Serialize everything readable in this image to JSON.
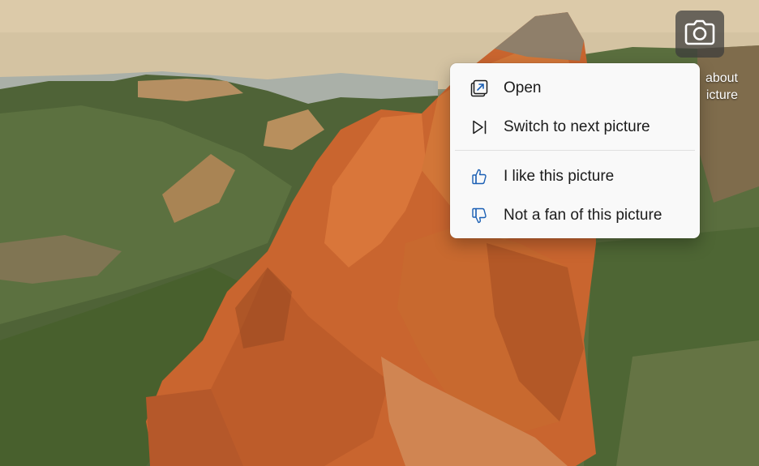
{
  "camera_button": {
    "icon": "camera-icon"
  },
  "caption": {
    "line1": "about",
    "line2": "icture"
  },
  "context_menu": {
    "items": [
      {
        "label": "Open",
        "icon": "open-external-icon"
      },
      {
        "label": "Switch to next picture",
        "icon": "next-track-icon"
      },
      {
        "label": "I like this picture",
        "icon": "thumbs-up-icon"
      },
      {
        "label": "Not a fan of this picture",
        "icon": "thumbs-down-icon"
      }
    ]
  },
  "colors": {
    "accent": "#1a5fb4",
    "menu_bg": "#f9f9f9",
    "text": "#1b1b1b"
  }
}
